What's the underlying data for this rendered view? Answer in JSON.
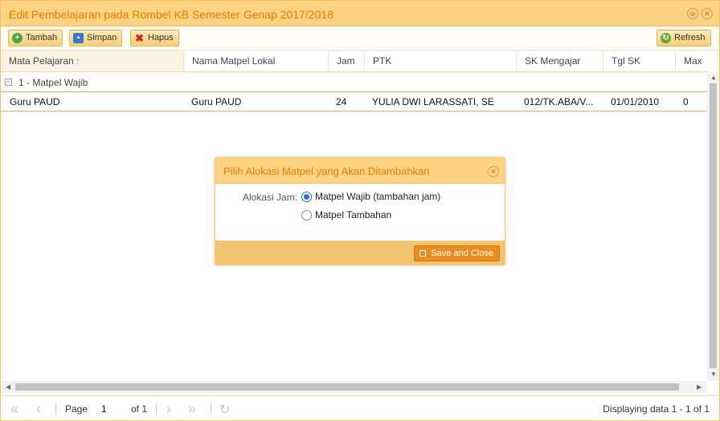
{
  "window": {
    "title": "Edit Pembelajaran pada Rombel KB Semester Genap 2017/2018"
  },
  "toolbar": {
    "tambah": "Tambah",
    "simpan": "Simpan",
    "hapus": "Hapus",
    "refresh": "Refresh"
  },
  "grid": {
    "columns": [
      "Mata Pelajaran",
      "Nama Matpel Lokal",
      "Jam",
      "PTK",
      "SK Mengajar",
      "Tgl SK",
      "Max"
    ],
    "sorted_column": "Mata Pelajaran",
    "group_label": "1 - Matpel Wajib",
    "rows": [
      {
        "mata_pelajaran": "Guru PAUD",
        "nama_matpel_lokal": "Guru PAUD",
        "jam": "24",
        "ptk": "YULIA DWI LARASSATI, SE",
        "sk_mengajar": "012/TK.ABA/V...",
        "tgl_sk": "01/01/2010",
        "max": "0"
      }
    ]
  },
  "pager": {
    "page_label": "Page",
    "page_value": "1",
    "of_label": "of 1",
    "info": "Displaying data 1 - 1 of 1"
  },
  "dialog": {
    "title": "Pilih Alokasi Matpel yang Akan Ditambahkan",
    "label": "Alokasi Jam:",
    "options": [
      {
        "label": "Matpel Wajib (tambahan jam)",
        "checked": true
      },
      {
        "label": "Matpel Tambahan",
        "checked": false
      }
    ],
    "save_label": "Save and Close"
  },
  "colors": {
    "accent": "#fcd382",
    "title_text": "#e67e00",
    "button_primary": "#e88d1f"
  },
  "icons": {
    "add": "plus-circle-icon",
    "save": "floppy-icon",
    "delete": "x-icon",
    "refresh": "refresh-icon"
  }
}
